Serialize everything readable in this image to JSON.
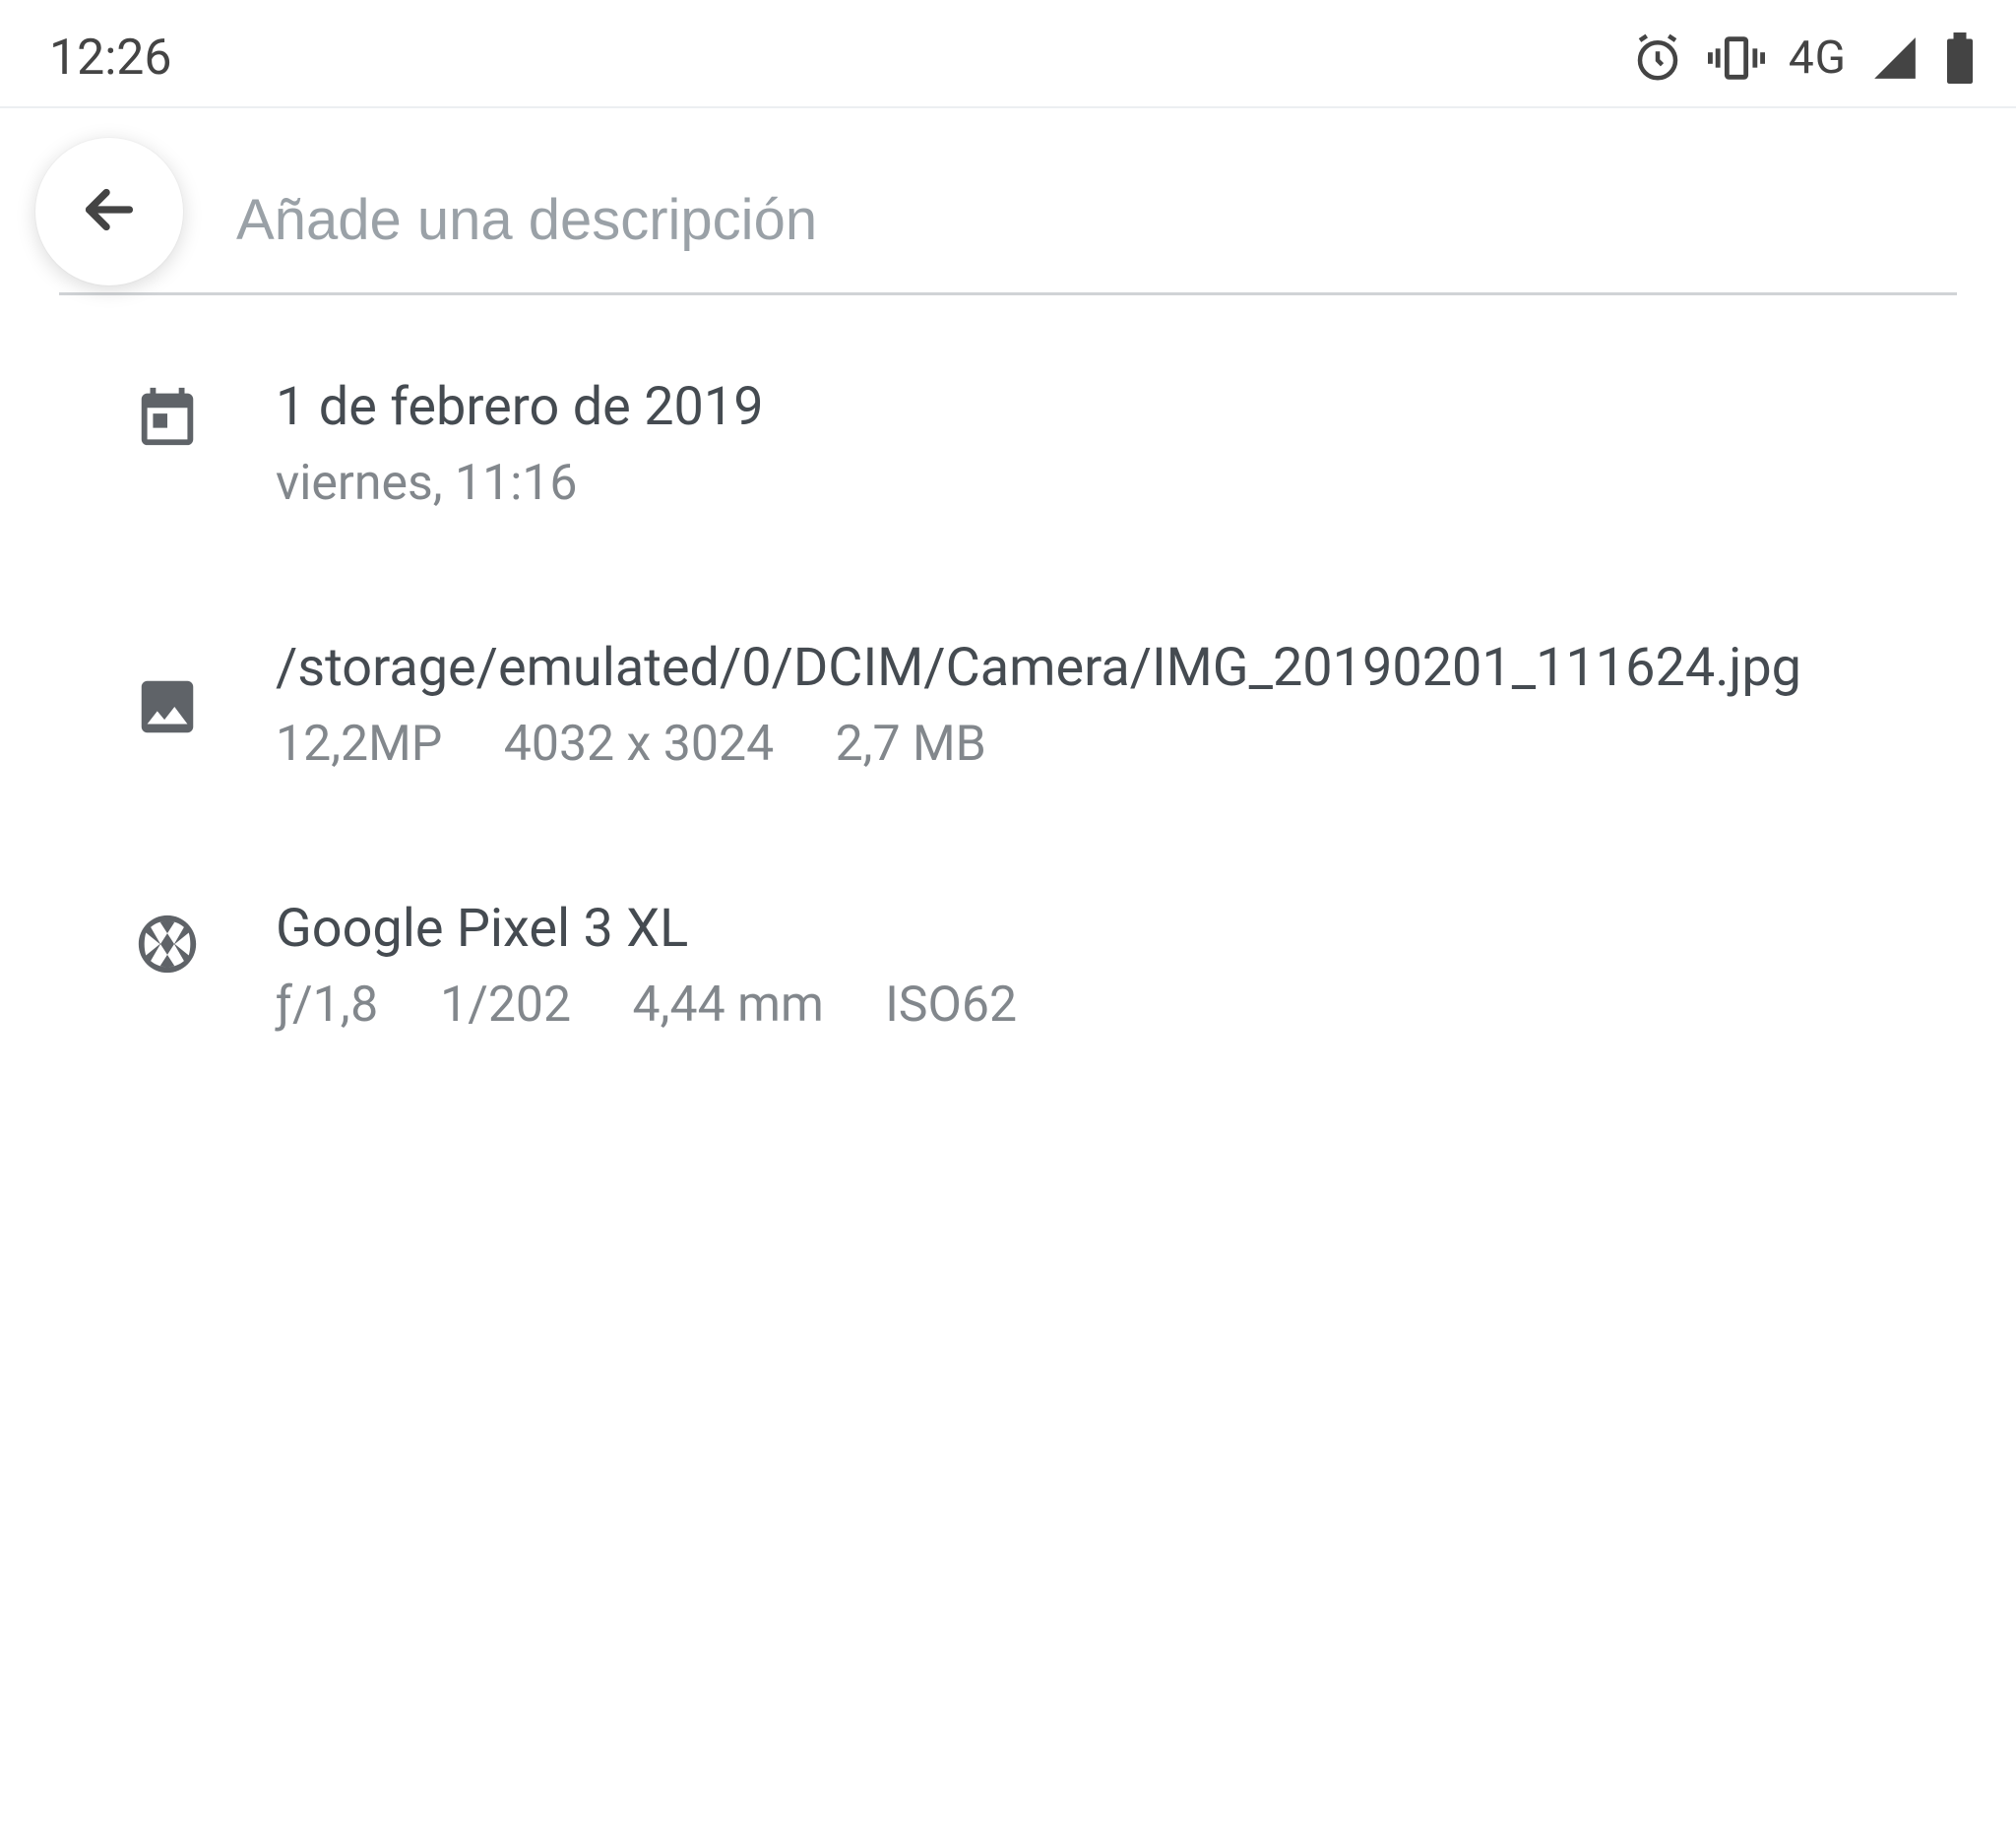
{
  "status": {
    "time": "12:26",
    "network_label": "4G"
  },
  "header": {
    "description_placeholder": "Añade una descripción"
  },
  "date_row": {
    "date": "1 de febrero de 2019",
    "day_time": "viernes, 11:16"
  },
  "file_row": {
    "path": "/storage/emulated/0/DCIM/Camera/IMG_20190201_111624.jpg",
    "megapixels": "12,2MP",
    "dimensions": "4032 x 3024",
    "size": "2,7 MB"
  },
  "camera_row": {
    "device": "Google Pixel 3 XL",
    "aperture": "ƒ/1,8",
    "shutter": "1/202",
    "focal_length": "4,44 mm",
    "iso": "ISO62"
  }
}
